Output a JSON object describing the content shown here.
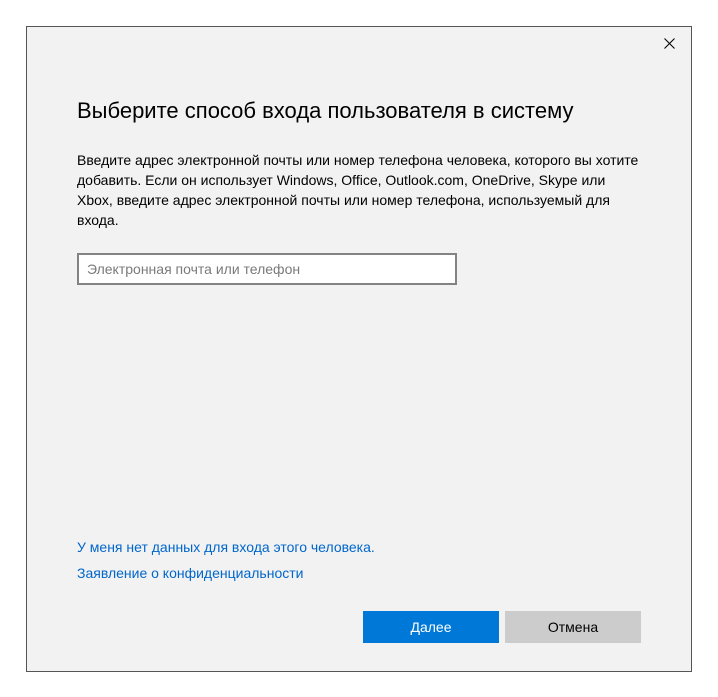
{
  "heading": "Выберите способ входа пользователя в систему",
  "description": "Введите адрес электронной почты или номер телефона человека, которого вы хотите добавить. Если он использует Windows, Office, Outlook.com, OneDrive, Skype или Xbox, введите адрес электронной почты или номер телефона, используемый для входа.",
  "input": {
    "placeholder": "Электронная почта или телефон",
    "value": ""
  },
  "links": {
    "no_credentials": "У меня нет данных для входа этого человека.",
    "privacy": "Заявление о конфиденциальности"
  },
  "buttons": {
    "next": "Далее",
    "cancel": "Отмена"
  }
}
